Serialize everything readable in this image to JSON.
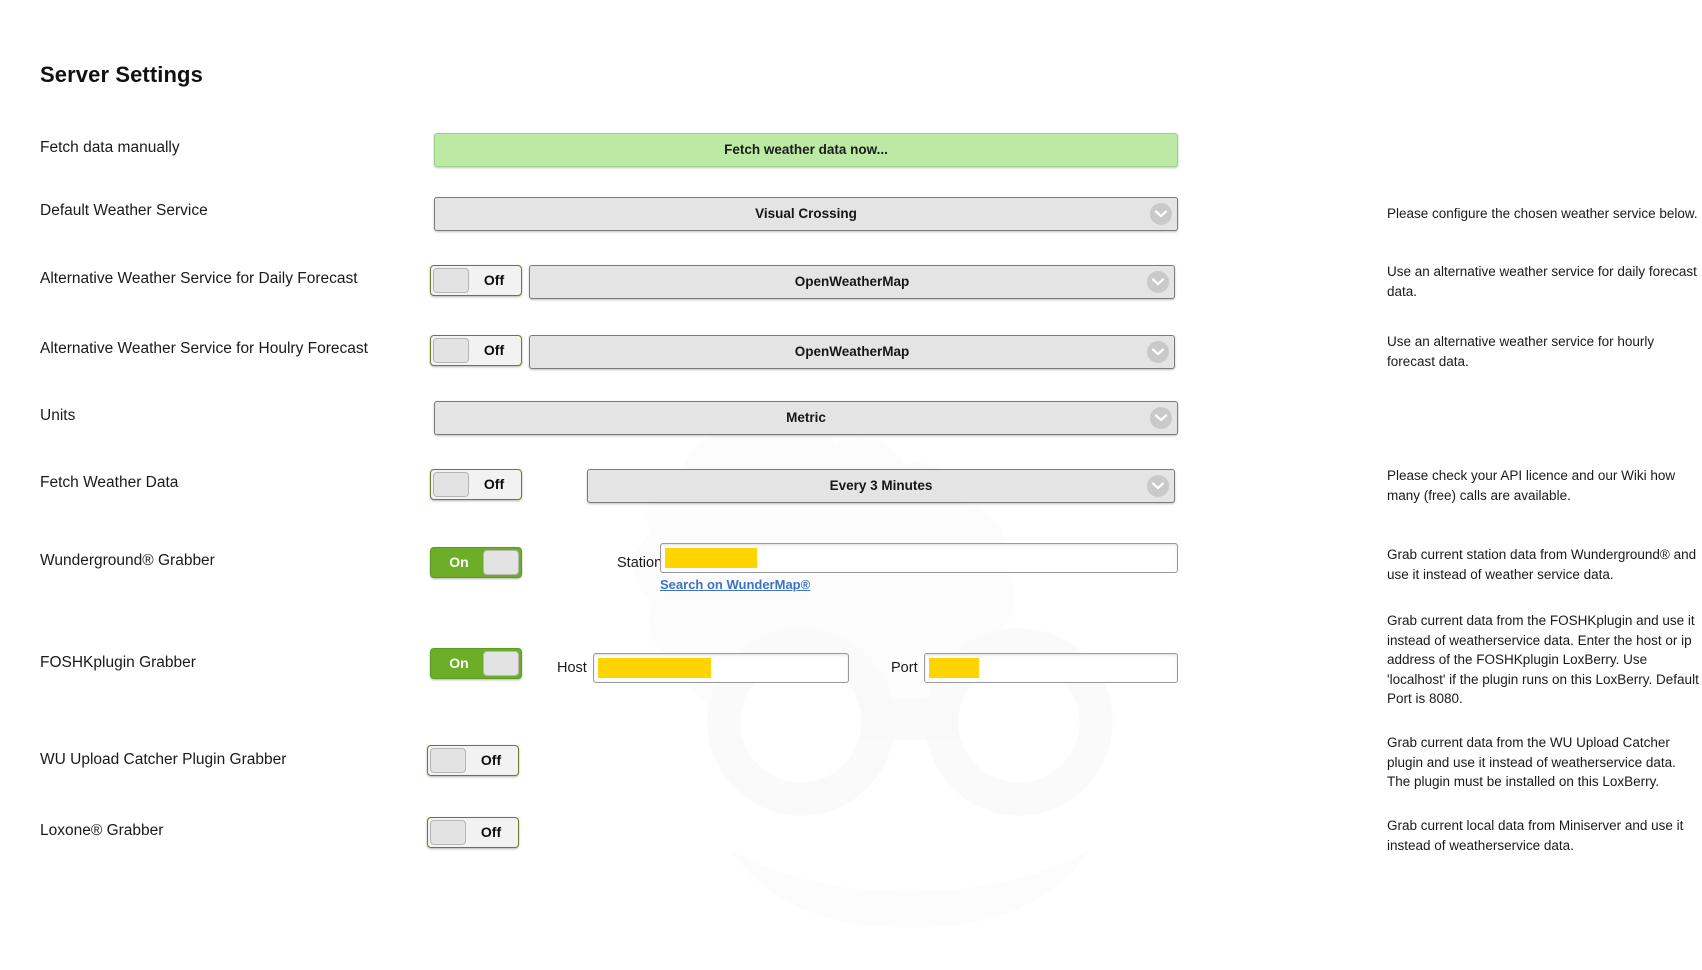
{
  "page": {
    "title": "Server Settings"
  },
  "rows": [
    {
      "label": "Fetch data manually",
      "button": "Fetch weather data now...",
      "help": ""
    },
    {
      "label": "Default Weather Service",
      "select": "Visual Crossing",
      "help": "Please configure the chosen weather service below."
    },
    {
      "label": "Alternative Weather Service for Daily Forecast",
      "toggle": "Off",
      "select": "OpenWeatherMap",
      "help": "Use an alternative weather service for daily forecast data."
    },
    {
      "label": "Alternative Weather Service for Houlry Forecast",
      "toggle": "Off",
      "select": "OpenWeatherMap",
      "help": "Use an alternative weather service for hourly forecast data."
    },
    {
      "label": "Units",
      "select": "Metric",
      "help": ""
    },
    {
      "label": "Fetch Weather Data",
      "toggle": "Off",
      "select": "Every 3 Minutes",
      "help": "Please check your API licence and our Wiki how many (free) calls are available."
    },
    {
      "label": "Wunderground® Grabber",
      "toggle": "On",
      "field_label": "Station-ID",
      "field_value": "",
      "link": "Search on WunderMap®",
      "help": "Grab current station data from Wunderground® and use it instead of weather service data."
    },
    {
      "label": "FOSHKplugin Grabber",
      "toggle": "On",
      "host_label": "Host",
      "host_value": "",
      "port_label": "Port",
      "port_value": "",
      "help": "Grab current data from the FOSHKplugin and use it instead of weatherservice data. Enter the host or ip address of the FOSHKplugin LoxBerry. Use 'localhost' if the plugin runs on this LoxBerry. Default Port is 8080."
    },
    {
      "label": "WU Upload Catcher Plugin Grabber",
      "toggle": "Off",
      "help": "Grab current data from the WU Upload Catcher plugin and use it instead of weatherservice data. The plugin must be installed on this LoxBerry."
    },
    {
      "label": "Loxone® Grabber",
      "toggle": "Off",
      "help": "Grab current local data from Miniserver and use it instead of weatherservice data."
    }
  ],
  "icons": {
    "chevron_down": "chevron-down-icon"
  },
  "colors": {
    "button_green": "#bce9a4",
    "toggle_on_green": "#6cae28",
    "select_grey": "#e4e4e4",
    "redacted_yellow": "#ffd400",
    "link_blue": "#3b74c4"
  }
}
